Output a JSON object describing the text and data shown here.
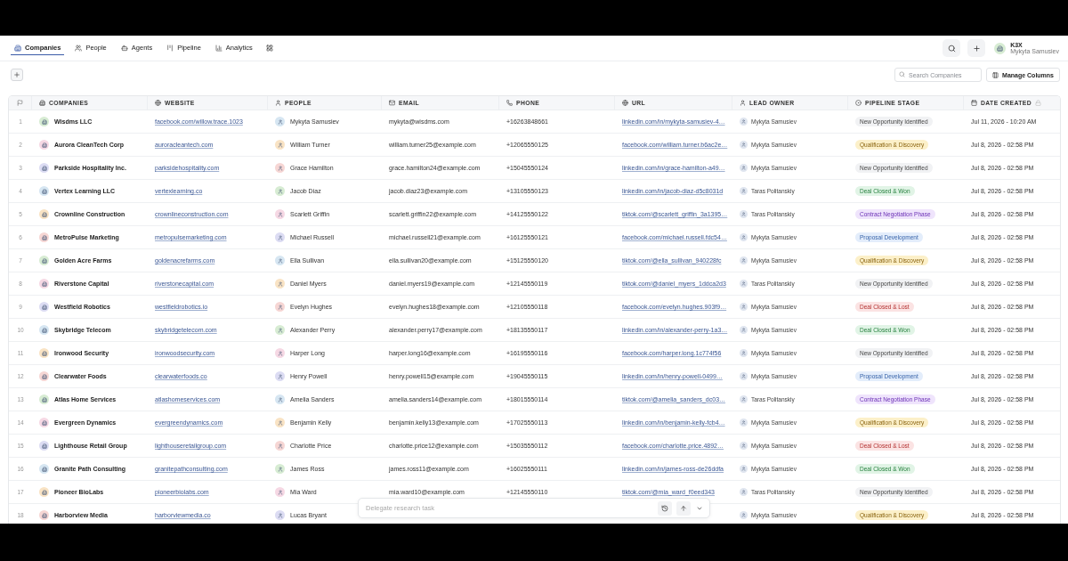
{
  "nav": {
    "tabs": [
      {
        "label": "Companies",
        "selected": true
      },
      {
        "label": "People",
        "selected": false
      },
      {
        "label": "Agents",
        "selected": false
      },
      {
        "label": "Pipeline",
        "selected": false
      },
      {
        "label": "Analytics",
        "selected": false
      }
    ]
  },
  "account": {
    "org": "K3X",
    "user": "Mykyta Samusiev"
  },
  "toolbar": {
    "search": {
      "placeholder": "Search Companies"
    },
    "manage_columns": "Manage Columns"
  },
  "table": {
    "columns": [
      "COMPANIES",
      "WEBSITE",
      "PEOPLE",
      "EMAIL",
      "PHONE",
      "URL",
      "LEAD OWNER",
      "PIPELINE STAGE",
      "DATE CREATED"
    ],
    "rows": [
      {
        "number": "1",
        "company": "Wisdms LLC",
        "website": "facebook.com/willow.trace.1023",
        "person": "Mykyta Samusiev",
        "email": "mykyta@wisdms.com",
        "phone": "+16263848661",
        "url": "linkedin.com/in/mykyta-samusiev-4…",
        "lead_owner": "Mykyta Samusiev",
        "stage": {
          "label": "New Opportunity Identified",
          "kind": "new"
        },
        "date": "Jul 11, 2026 - 10:20 AM"
      },
      {
        "number": "2",
        "company": "Aurora CleanTech Corp",
        "website": "auroracleantech.com",
        "person": "William Turner",
        "email": "william.turner25@example.com",
        "phone": "+12065550125",
        "url": "facebook.com/william.turner.b6ac2e…",
        "lead_owner": "Mykyta Samusiev",
        "stage": {
          "label": "Qualification & Discovery",
          "kind": "qualification"
        },
        "date": "Jul 8, 2026 - 02:58 PM"
      },
      {
        "number": "3",
        "company": "Parkside Hospitality Inc.",
        "website": "parksidehospitality.com",
        "person": "Grace Hamilton",
        "email": "grace.hamilton24@example.com",
        "phone": "+15045550124",
        "url": "linkedin.com/in/grace-hamilton-a49…",
        "lead_owner": "Mykyta Samusiev",
        "stage": {
          "label": "New Opportunity Identified",
          "kind": "new"
        },
        "date": "Jul 8, 2026 - 02:58 PM"
      },
      {
        "number": "4",
        "company": "Vertex Learning LLC",
        "website": "vertexlearning.co",
        "person": "Jacob Diaz",
        "email": "jacob.diaz23@example.com",
        "phone": "+13105550123",
        "url": "linkedin.com/in/jacob-diaz-d5c8031d",
        "lead_owner": "Taras Politanskiy",
        "stage": {
          "label": "Deal Closed & Won",
          "kind": "won"
        },
        "date": "Jul 8, 2026 - 02:58 PM"
      },
      {
        "number": "5",
        "company": "Crownline Construction",
        "website": "crownlineconstruction.com",
        "person": "Scarlett Griffin",
        "email": "scarlett.griffin22@example.com",
        "phone": "+14125550122",
        "url": "tiktok.com/@scarlett_griffin_3a1395…",
        "lead_owner": "Taras Politanskiy",
        "stage": {
          "label": "Contract Negotiation Phase",
          "kind": "contract"
        },
        "date": "Jul 8, 2026 - 02:58 PM"
      },
      {
        "number": "6",
        "company": "MetroPulse Marketing",
        "website": "metropulsemarketing.com",
        "person": "Michael Russell",
        "email": "michael.russell21@example.com",
        "phone": "+16125550121",
        "url": "facebook.com/michael.russell.fdc54…",
        "lead_owner": "Mykyta Samusiev",
        "stage": {
          "label": "Proposal Development",
          "kind": "proposal"
        },
        "date": "Jul 8, 2026 - 02:58 PM"
      },
      {
        "number": "7",
        "company": "Golden Acre Farms",
        "website": "goldenacrefarms.com",
        "person": "Ella Sullivan",
        "email": "ella.sullivan20@example.com",
        "phone": "+15125550120",
        "url": "tiktok.com/@ella_sullivan_940228fc",
        "lead_owner": "Mykyta Samusiev",
        "stage": {
          "label": "Qualification & Discovery",
          "kind": "qualification"
        },
        "date": "Jul 8, 2026 - 02:58 PM"
      },
      {
        "number": "8",
        "company": "Riverstone Capital",
        "website": "riverstonecapital.com",
        "person": "Daniel Myers",
        "email": "daniel.myers19@example.com",
        "phone": "+12145550119",
        "url": "tiktok.com/@daniel_myers_1ddca2d3",
        "lead_owner": "Taras Politanskiy",
        "stage": {
          "label": "New Opportunity Identified",
          "kind": "new"
        },
        "date": "Jul 8, 2026 - 02:58 PM"
      },
      {
        "number": "9",
        "company": "Westfield Robotics",
        "website": "westfieldrobotics.io",
        "person": "Evelyn Hughes",
        "email": "evelyn.hughes18@example.com",
        "phone": "+12105550118",
        "url": "facebook.com/evelyn.hughes.903f9…",
        "lead_owner": "Mykyta Samusiev",
        "stage": {
          "label": "Deal Closed & Lost",
          "kind": "lost"
        },
        "date": "Jul 8, 2026 - 02:58 PM"
      },
      {
        "number": "10",
        "company": "Skybridge Telecom",
        "website": "skybridgetelecom.com",
        "person": "Alexander Perry",
        "email": "alexander.perry17@example.com",
        "phone": "+18135550117",
        "url": "linkedin.com/in/alexander-perry-1a3…",
        "lead_owner": "Mykyta Samusiev",
        "stage": {
          "label": "Deal Closed & Won",
          "kind": "won"
        },
        "date": "Jul 8, 2026 - 02:58 PM"
      },
      {
        "number": "11",
        "company": "Ironwood Security",
        "website": "ironwoodsecurity.com",
        "person": "Harper Long",
        "email": "harper.long16@example.com",
        "phone": "+16195550116",
        "url": "facebook.com/harper.long.1c774f56",
        "lead_owner": "Mykyta Samusiev",
        "stage": {
          "label": "New Opportunity Identified",
          "kind": "new"
        },
        "date": "Jul 8, 2026 - 02:58 PM"
      },
      {
        "number": "12",
        "company": "Clearwater Foods",
        "website": "clearwaterfoods.co",
        "person": "Henry Powell",
        "email": "henry.powell15@example.com",
        "phone": "+19045550115",
        "url": "linkedin.com/in/henry-powell-0499…",
        "lead_owner": "Mykyta Samusiev",
        "stage": {
          "label": "Proposal Development",
          "kind": "proposal"
        },
        "date": "Jul 8, 2026 - 02:58 PM"
      },
      {
        "number": "13",
        "company": "Atlas Home Services",
        "website": "atlashomeservices.com",
        "person": "Amelia Sanders",
        "email": "amelia.sanders14@example.com",
        "phone": "+18015550114",
        "url": "tiktok.com/@amelia_sanders_dc03…",
        "lead_owner": "Taras Politanskiy",
        "stage": {
          "label": "Contract Negotiation Phase",
          "kind": "contract"
        },
        "date": "Jul 8, 2026 - 02:58 PM"
      },
      {
        "number": "14",
        "company": "Evergreen Dynamics",
        "website": "evergreendynamics.com",
        "person": "Benjamin Kelly",
        "email": "benjamin.kelly13@example.com",
        "phone": "+17025550113",
        "url": "linkedin.com/in/benjamin-kelly-fcb4…",
        "lead_owner": "Mykyta Samusiev",
        "stage": {
          "label": "Qualification & Discovery",
          "kind": "qualification"
        },
        "date": "Jul 8, 2026 - 02:58 PM"
      },
      {
        "number": "15",
        "company": "Lighthouse Retail Group",
        "website": "lighthouseretailgroup.com",
        "person": "Charlotte Price",
        "email": "charlotte.price12@example.com",
        "phone": "+15035550112",
        "url": "facebook.com/charlotte.price.4892…",
        "lead_owner": "Mykyta Samusiev",
        "stage": {
          "label": "Deal Closed & Lost",
          "kind": "lost"
        },
        "date": "Jul 8, 2026 - 02:58 PM"
      },
      {
        "number": "16",
        "company": "Granite Path Consulting",
        "website": "granitepathconsulting.com",
        "person": "James Ross",
        "email": "james.ross11@example.com",
        "phone": "+16025550111",
        "url": "linkedin.com/in/james-ross-de26ddfa",
        "lead_owner": "Mykyta Samusiev",
        "stage": {
          "label": "Deal Closed & Won",
          "kind": "won"
        },
        "date": "Jul 8, 2026 - 02:58 PM"
      },
      {
        "number": "17",
        "company": "Pioneer BioLabs",
        "website": "pioneerbiolabs.com",
        "person": "Mia Ward",
        "email": "mia.ward10@example.com",
        "phone": "+12145550110",
        "url": "tiktok.com/@mia_ward_f0eed343",
        "lead_owner": "Taras Politanskiy",
        "stage": {
          "label": "New Opportunity Identified",
          "kind": "new"
        },
        "date": "Jul 8, 2026 - 02:58 PM"
      },
      {
        "number": "18",
        "company": "Harborview Media",
        "website": "harborviewmedia.co",
        "person": "Lucas Bryant",
        "lead_owner": "Mykyta Samusiev",
        "stage": {
          "label": "Qualification & Discovery",
          "kind": "qualification"
        },
        "date": "Jul 8, 2026 - 02:58 PM"
      }
    ]
  },
  "composer": {
    "placeholder": "Delegate research task"
  }
}
